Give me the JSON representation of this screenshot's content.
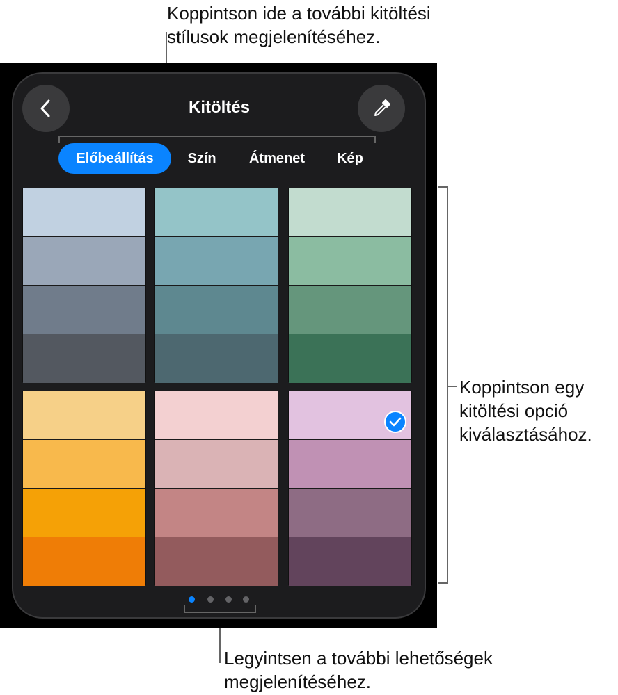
{
  "callouts": {
    "top_line1": "Koppintson ide a további kitöltési",
    "top_line2": "stílusok megjelenítéséhez.",
    "right_line1": "Koppintson egy",
    "right_line2": "kitöltési opció",
    "right_line3": "kiválasztásához.",
    "bottom_line1": "Legyintsen a további lehetőségek",
    "bottom_line2": "megjelenítéséhez."
  },
  "header": {
    "title": "Kitöltés",
    "back_icon": "chevron-left-icon",
    "picker_icon": "eyedropper-icon"
  },
  "tabs": [
    {
      "label": "Előbeállítás",
      "active": true
    },
    {
      "label": "Szín",
      "active": false
    },
    {
      "label": "Átmenet",
      "active": false
    },
    {
      "label": "Kép",
      "active": false
    }
  ],
  "swatch_groups": [
    {
      "colors": [
        "#c1d1e1",
        "#9aa7b8",
        "#707c8b",
        "#535860"
      ],
      "selected": false
    },
    {
      "colors": [
        "#94c4c8",
        "#78a6b1",
        "#5e8890",
        "#4d6870"
      ],
      "selected": false
    },
    {
      "colors": [
        "#c2dccf",
        "#8bbca1",
        "#65967c",
        "#3b7257"
      ],
      "selected": false
    },
    {
      "colors": [
        "#f6d088",
        "#f8b94c",
        "#f5a106",
        "#ef7d06"
      ],
      "selected": false
    },
    {
      "colors": [
        "#f3d0d1",
        "#dab3b5",
        "#c38585",
        "#935b5d"
      ],
      "selected": false
    },
    {
      "colors": [
        "#e2c2e0",
        "#c091b4",
        "#8e6c84",
        "#62445c"
      ],
      "selected": true
    }
  ],
  "pager": {
    "pages": 4,
    "current": 1
  },
  "colors": {
    "accent": "#0a84ff",
    "sheet_bg": "#1c1c1e",
    "button_bg": "#3a3a3c"
  }
}
